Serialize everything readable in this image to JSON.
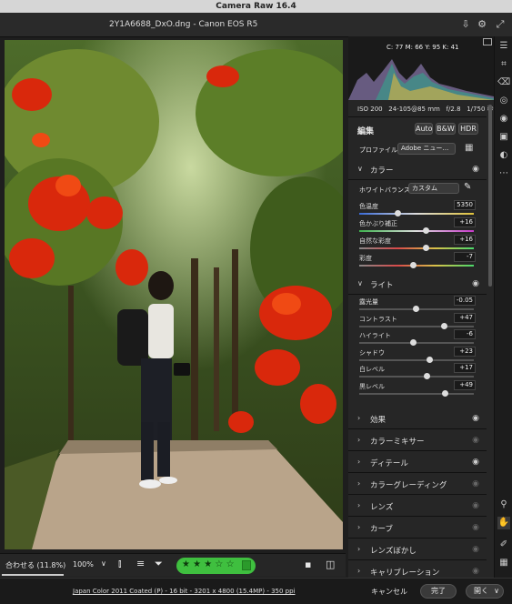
{
  "app": {
    "title": "Camera Raw 16.4",
    "filename": "2Y1A6688_DxO.dng - Canon EOS R5"
  },
  "histogram": {
    "readout": "C: 77  M: 66  Y: 95  K: 41",
    "exif": {
      "iso": "ISO 200",
      "lens": "24-105@85 mm",
      "aperture": "f/2.8",
      "shutter": "1/750 秒"
    }
  },
  "edit": {
    "title": "編集",
    "buttons": [
      "Auto",
      "B&W",
      "HDR"
    ],
    "profile_label": "プロファイル",
    "profile_value": "Adobe ニュー…"
  },
  "color": {
    "title": "カラー",
    "wb_label": "ホワイトバランス",
    "wb_value": "カスタム",
    "sliders": [
      {
        "label": "色温度",
        "value": "5350",
        "pos": 0.33,
        "track": "temp"
      },
      {
        "label": "色かぶり補正",
        "value": "+16",
        "pos": 0.58,
        "track": "tint"
      },
      {
        "label": "自然な彩度",
        "value": "+16",
        "pos": 0.58,
        "track": "sat"
      },
      {
        "label": "彩度",
        "value": "-7",
        "pos": 0.47,
        "track": "sat"
      }
    ]
  },
  "light": {
    "title": "ライト",
    "sliders": [
      {
        "label": "露光量",
        "value": "-0.05",
        "pos": 0.495
      },
      {
        "label": "コントラスト",
        "value": "+47",
        "pos": 0.735
      },
      {
        "label": "ハイライト",
        "value": "-6",
        "pos": 0.47
      },
      {
        "label": "シャドウ",
        "value": "+23",
        "pos": 0.615
      },
      {
        "label": "白レベル",
        "value": "+17",
        "pos": 0.585
      },
      {
        "label": "黒レベル",
        "value": "+49",
        "pos": 0.745
      }
    ]
  },
  "sections": [
    {
      "label": "効果",
      "eye_dim": false
    },
    {
      "label": "カラーミキサー",
      "eye_dim": true
    },
    {
      "label": "ディテール",
      "eye_dim": false
    },
    {
      "label": "カラーグレーディング",
      "eye_dim": true
    },
    {
      "label": "レンズ",
      "eye_dim": true
    },
    {
      "label": "カーブ",
      "eye_dim": true
    },
    {
      "label": "レンズぼかし",
      "eye_dim": true
    },
    {
      "label": "キャリブレーション",
      "eye_dim": true
    }
  ],
  "bottom": {
    "fit": "合わせる (11.8%)",
    "zoom": "100%",
    "rating": "★ ★ ★ ☆ ☆"
  },
  "footer": {
    "info": "Japan Color 2011 Coated (P) - 16 bit - 3201 x 4800 (15.4MP) - 350 ppi",
    "cancel": "キャンセル",
    "done": "完了",
    "open": "開く"
  },
  "colors": {
    "accent": "#2a7de1",
    "rating_bg": "#3fbf3f"
  }
}
